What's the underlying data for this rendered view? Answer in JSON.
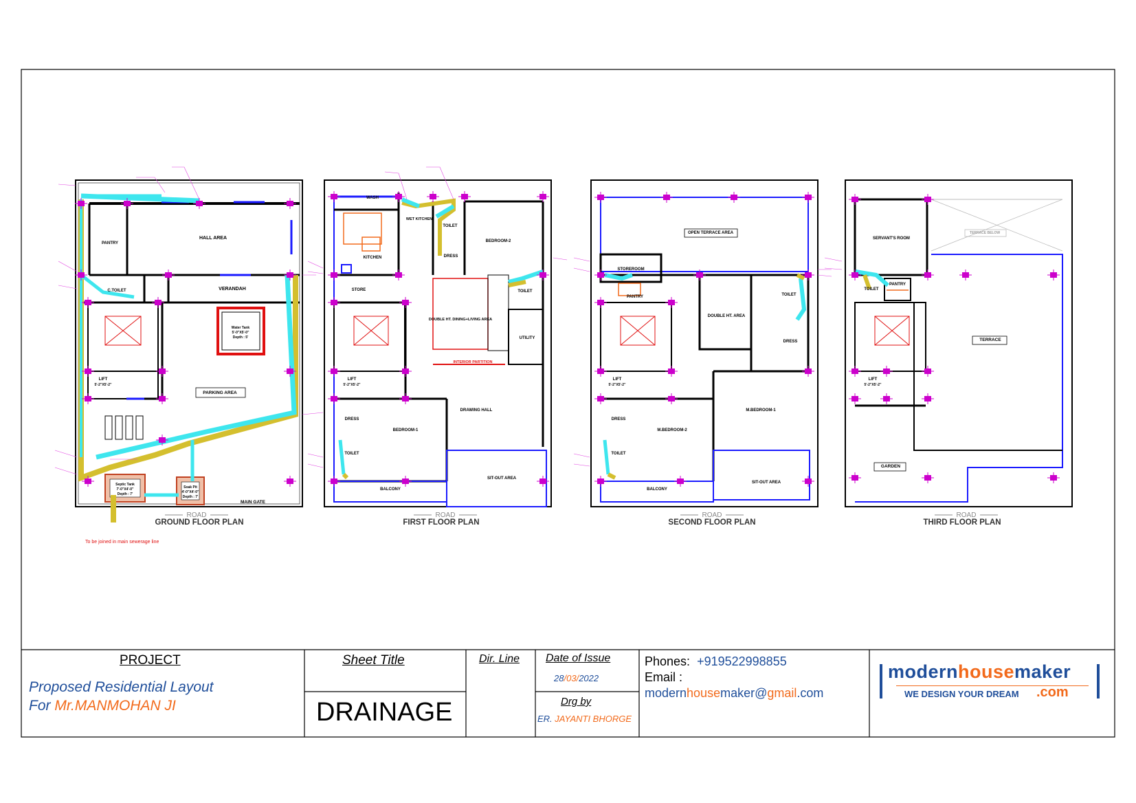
{
  "plans": [
    {
      "title": "GROUND FLOOR PLAN",
      "road": "ROAD",
      "rooms": [
        "HALL AREA",
        "PANTRY",
        "C.TOILET",
        "VERANDAH",
        "LIFT",
        "5'-2\"X5'-2\"",
        "PARKING AREA",
        "MAIN GATE"
      ],
      "tank": [
        "Water Tank",
        "5'-0\"X5'-0\"",
        "Depth : 5'"
      ],
      "septic": [
        "Septic Tank",
        "7'-0\"X4'-0\"",
        "Depth : 7'"
      ],
      "soak": [
        "Soak Pit",
        "4'-0\"X4'-0\"",
        "Depth : 7'"
      ]
    },
    {
      "title": "FIRST FLOOR PLAN",
      "road": "ROAD",
      "rooms": [
        "WASH",
        "WET KITCHEN",
        "KITCHEN",
        "TOILET",
        "DRESS",
        "BEDROOM-2",
        "STORE",
        "DOUBLE HT. DINING+LIVING AREA",
        "UTILITY",
        "TOILET",
        "INTERIOR PARTITION",
        "LIFT",
        "5'-2\"X5'-2\"",
        "DRESS",
        "TOILET",
        "BEDROOM-1",
        "DRAWING HALL",
        "BALCONY",
        "SIT-OUT AREA"
      ]
    },
    {
      "title": "SECOND FLOOR PLAN",
      "road": "ROAD",
      "rooms": [
        "OPEN TERRACE AREA",
        "STOREROOM",
        "PANTRY",
        "DOUBLE HT. AREA",
        "TOILET",
        "DRESS",
        "LIFT",
        "5'-2\"X5'-2\"",
        "DRESS",
        "TOILET",
        "M.BEDROOM-2",
        "M.BEDROOM-1",
        "BALCONY",
        "SIT-OUT AREA"
      ]
    },
    {
      "title": "THIRD FLOOR PLAN",
      "road": "ROAD",
      "rooms": [
        "SERVANT'S ROOM",
        "TERRACE BELOW",
        "TOILET",
        "PANTRY",
        "TERRACE",
        "LIFT",
        "5'-2\"X5'-2\"",
        "GARDEN"
      ]
    }
  ],
  "note": "To be joined in main sewerage line",
  "title_block": {
    "project_label": "PROJECT",
    "project_line1": "Proposed Residential Layout",
    "project_line2_prefix": "For ",
    "project_line2_name": "Mr.MANMOHAN JI",
    "sheet_title_label": "Sheet Title",
    "sheet_title": "DRAINAGE",
    "dir_line_label": "Dir. Line",
    "date_label": "Date of Issue",
    "date_d": "28",
    "date_m": "03",
    "date_y": "2022",
    "date_sep": "/",
    "drg_by_label": "Drg by",
    "drg_by_prefix": "ER. ",
    "drg_by_name": "JAYANTI BHORGE",
    "phones_label": "Phones:",
    "phone": "+919522998855",
    "email_label": "Email :",
    "email_a": "modern",
    "email_b": "house",
    "email_c": "maker@",
    "email_d": "gmail",
    "email_e": ".com",
    "logo_a": "modern",
    "logo_b": "house",
    "logo_c": "maker",
    "logo_tagline": "WE DESIGN YOUR DREAM",
    "logo_com": ".com"
  },
  "colors": {
    "pipe_main": "#d4bf2e",
    "pipe_branch": "#3ee6ee",
    "columns": "#cc00cc",
    "walls_blue": "#1a1aff",
    "red": "#e01010",
    "brand_blue": "#1f4e9a",
    "brand_orange": "#f26a1b"
  },
  "icons": [
    "cross-bracing-icon",
    "column-marker-icon",
    "pipe-route-icon",
    "arrow-icon"
  ]
}
